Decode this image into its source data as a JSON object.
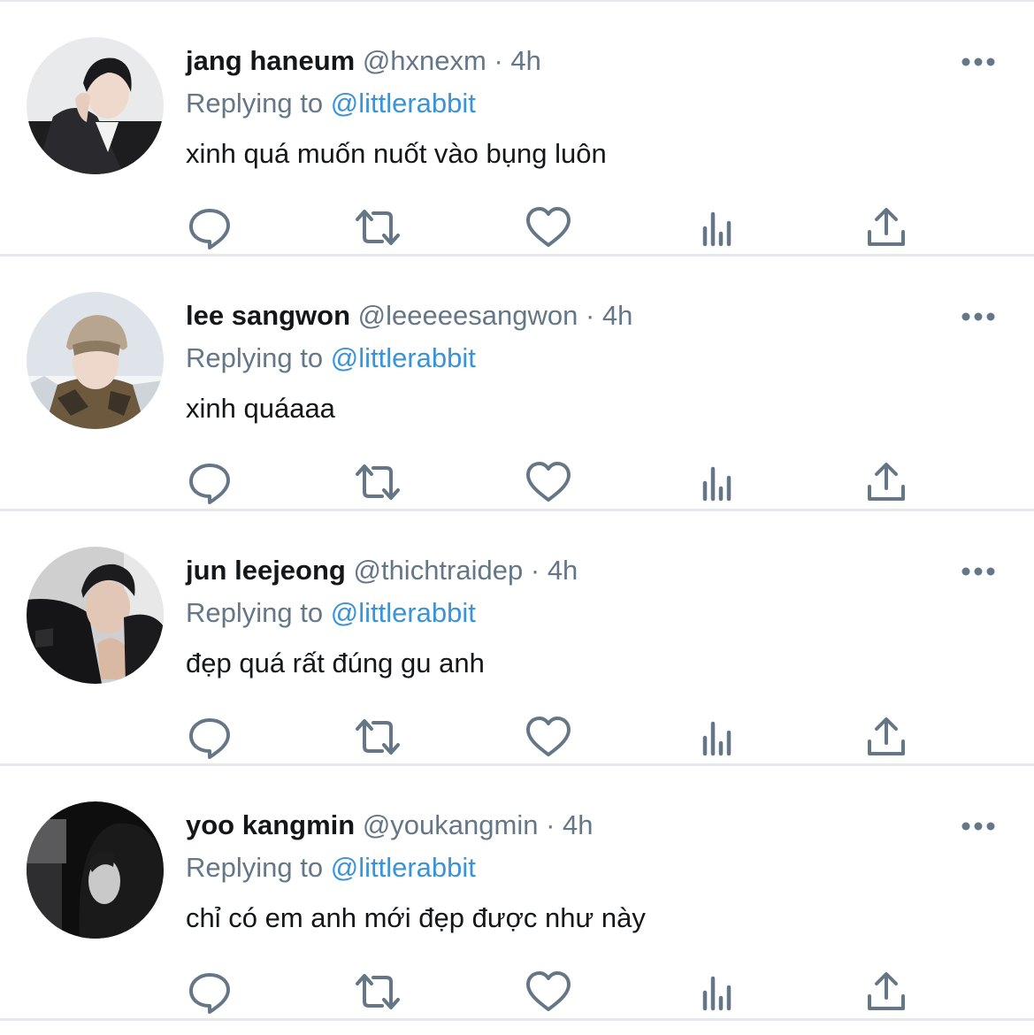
{
  "colors": {
    "mention": "#3a92d8",
    "secondary_text": "#657786",
    "primary_text": "#14171a",
    "icon": "#657786",
    "divider": "#e6e9ec"
  },
  "tweets": [
    {
      "name": "jang haneum",
      "handle": "@hxnexm",
      "separator": "·",
      "time": "4h",
      "replying_prefix": "Replying to",
      "replying_to": "@littlerabbit",
      "text": "xinh quá muốn nuốt vào bụng luôn",
      "avatar": "profile-photo"
    },
    {
      "name": "lee sangwon",
      "handle": "@leeeeesangwon",
      "separator": "·",
      "time": "4h",
      "replying_prefix": "Replying to",
      "replying_to": "@littlerabbit",
      "text": "xinh quáaaa",
      "avatar": "profile-photo"
    },
    {
      "name": "jun leejeong",
      "handle": "@thichtraidep",
      "separator": "·",
      "time": "4h",
      "replying_prefix": "Replying to",
      "replying_to": "@littlerabbit",
      "text": "đẹp quá rất đúng gu anh",
      "avatar": "profile-photo"
    },
    {
      "name": "yoo kangmin",
      "handle": "@youkangmin",
      "separator": "·",
      "time": "4h",
      "replying_prefix": "Replying to",
      "replying_to": "@littlerabbit",
      "text": "chỉ có em anh mới đẹp được như này",
      "avatar": "profile-photo"
    }
  ],
  "action_icons": [
    "reply-icon",
    "retweet-icon",
    "like-icon",
    "analytics-icon",
    "share-icon"
  ],
  "more_icon": "more-options-icon"
}
